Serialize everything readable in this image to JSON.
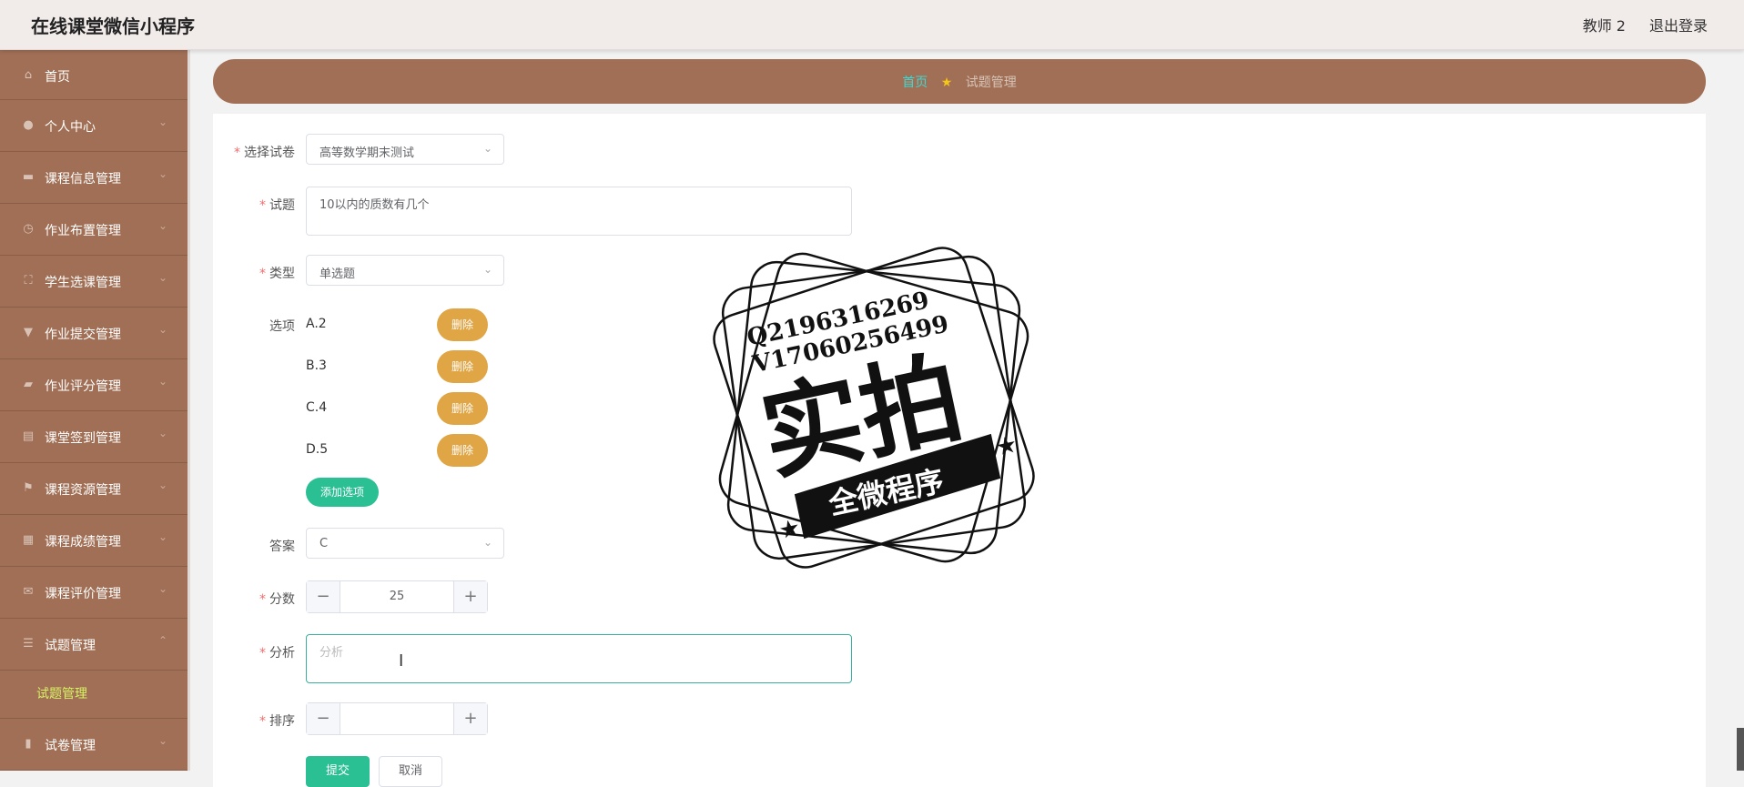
{
  "header": {
    "app_title": "在线课堂微信小程序",
    "user": "教师 2",
    "logout": "退出登录"
  },
  "sidebar": {
    "items": [
      {
        "label": "首页",
        "icon": "home-icon"
      },
      {
        "label": "个人中心",
        "icon": "user-icon"
      },
      {
        "label": "课程信息管理",
        "icon": "course-icon"
      },
      {
        "label": "作业布置管理",
        "icon": "clock-icon"
      },
      {
        "label": "学生选课管理",
        "icon": "select-icon"
      },
      {
        "label": "作业提交管理",
        "icon": "submit-icon"
      },
      {
        "label": "作业评分管理",
        "icon": "score-icon"
      },
      {
        "label": "课堂签到管理",
        "icon": "signin-icon"
      },
      {
        "label": "课程资源管理",
        "icon": "flag-icon"
      },
      {
        "label": "课程成绩管理",
        "icon": "grade-icon"
      },
      {
        "label": "课程评价管理",
        "icon": "mail-icon"
      },
      {
        "label": "试题管理",
        "icon": "list-icon"
      },
      {
        "label": "试卷管理",
        "icon": "chart-icon"
      }
    ],
    "submenu_label": "试题管理"
  },
  "breadcrumb": {
    "home": "首页",
    "current": "试题管理"
  },
  "form": {
    "paper_label": "选择试卷",
    "paper_value": "高等数学期末测试",
    "question_label": "试题",
    "question_value": "10以内的质数有几个",
    "type_label": "类型",
    "type_value": "单选题",
    "options_label": "选项",
    "options": [
      "A.2",
      "B.3",
      "C.4",
      "D.5"
    ],
    "delete_label": "删除",
    "add_option_label": "添加选项",
    "answer_label": "答案",
    "answer_value": "C",
    "score_label": "分数",
    "score_value": "25",
    "analysis_label": "分析",
    "analysis_placeholder": "分析",
    "order_label": "排序",
    "order_value": "",
    "submit_label": "提交",
    "cancel_label": "取消"
  },
  "watermark": {
    "line1": "Q2196316269",
    "line2": "V17060256499",
    "main": "实拍",
    "banner": "全微程序"
  }
}
